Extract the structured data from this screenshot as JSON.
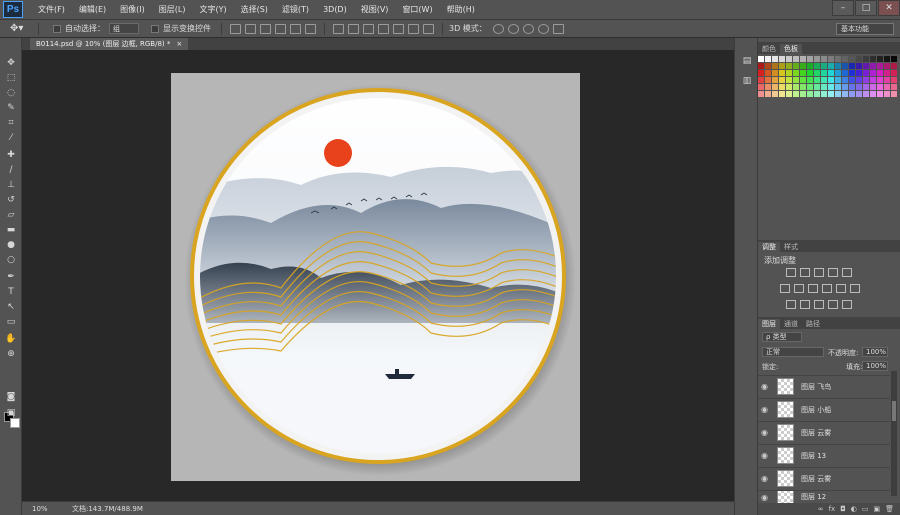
{
  "menubar": {
    "logo": "Ps",
    "items": [
      "文件(F)",
      "编辑(E)",
      "图像(I)",
      "图层(L)",
      "文字(Y)",
      "选择(S)",
      "滤镜(T)",
      "3D(D)",
      "视图(V)",
      "窗口(W)",
      "帮助(H)"
    ],
    "window_controls": [
      "–",
      "□",
      "✕"
    ]
  },
  "options": {
    "auto_select_label": "自动选择：",
    "auto_select_value": "组",
    "show_transform_label": "显示变换控件",
    "mode_3d_label": "3D 模式：",
    "workspace": "基本功能"
  },
  "document": {
    "tab_title": "B0114.psd @ 10% (图层 边框, RGB/8) *",
    "tab_close": "×"
  },
  "status": {
    "zoom": "10%",
    "doc_info": "文档:143.7M/488.9M"
  },
  "panels": {
    "swatch_tabs": [
      "颜色",
      "色板"
    ],
    "adjust_tabs": [
      "调整",
      "样式"
    ],
    "adjust_title": "添加调整",
    "layers_tabs": [
      "图层",
      "通道",
      "路径"
    ],
    "kind_label": "ρ 类型",
    "blend_mode": "正常",
    "opacity_label": "不透明度:",
    "opacity_value": "100%",
    "lock_label": "锁定:",
    "fill_label": "填充:",
    "fill_value": "100%",
    "layers": [
      {
        "name": "图层 飞鸟"
      },
      {
        "name": "图层 小船"
      },
      {
        "name": "图层 云雾"
      },
      {
        "name": "图层 13"
      },
      {
        "name": "图层 云雾"
      },
      {
        "name": "图层 12"
      }
    ],
    "bottom_icons": [
      "∞",
      "fx",
      "◘",
      "◐",
      "▭",
      "▣",
      "🗑"
    ]
  },
  "colors": {
    "sun": "#e8421c",
    "gold": "#d9a520"
  }
}
